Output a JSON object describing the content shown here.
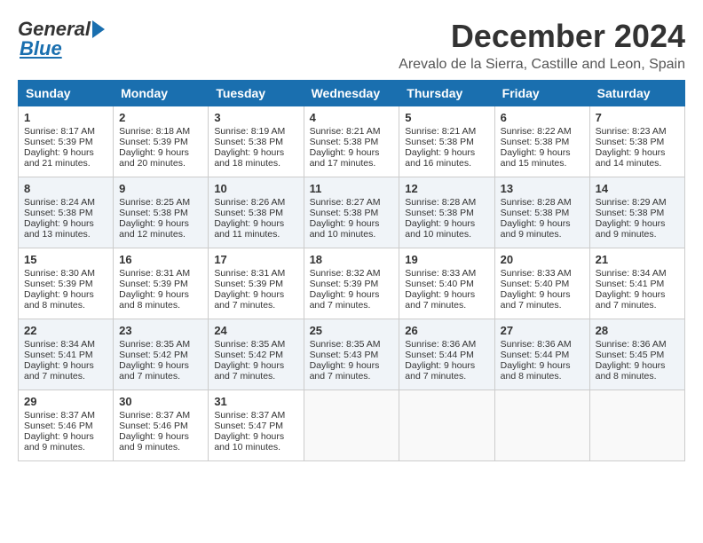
{
  "header": {
    "logo_general": "General",
    "logo_blue": "Blue",
    "month_title": "December 2024",
    "location": "Arevalo de la Sierra, Castille and Leon, Spain"
  },
  "weekdays": [
    "Sunday",
    "Monday",
    "Tuesday",
    "Wednesday",
    "Thursday",
    "Friday",
    "Saturday"
  ],
  "weeks": [
    [
      {
        "day": "1",
        "sunrise": "8:17 AM",
        "sunset": "5:39 PM",
        "daylight": "9 hours and 21 minutes."
      },
      {
        "day": "2",
        "sunrise": "8:18 AM",
        "sunset": "5:39 PM",
        "daylight": "9 hours and 20 minutes."
      },
      {
        "day": "3",
        "sunrise": "8:19 AM",
        "sunset": "5:38 PM",
        "daylight": "9 hours and 18 minutes."
      },
      {
        "day": "4",
        "sunrise": "8:21 AM",
        "sunset": "5:38 PM",
        "daylight": "9 hours and 17 minutes."
      },
      {
        "day": "5",
        "sunrise": "8:21 AM",
        "sunset": "5:38 PM",
        "daylight": "9 hours and 16 minutes."
      },
      {
        "day": "6",
        "sunrise": "8:22 AM",
        "sunset": "5:38 PM",
        "daylight": "9 hours and 15 minutes."
      },
      {
        "day": "7",
        "sunrise": "8:23 AM",
        "sunset": "5:38 PM",
        "daylight": "9 hours and 14 minutes."
      }
    ],
    [
      {
        "day": "8",
        "sunrise": "8:24 AM",
        "sunset": "5:38 PM",
        "daylight": "9 hours and 13 minutes."
      },
      {
        "day": "9",
        "sunrise": "8:25 AM",
        "sunset": "5:38 PM",
        "daylight": "9 hours and 12 minutes."
      },
      {
        "day": "10",
        "sunrise": "8:26 AM",
        "sunset": "5:38 PM",
        "daylight": "9 hours and 11 minutes."
      },
      {
        "day": "11",
        "sunrise": "8:27 AM",
        "sunset": "5:38 PM",
        "daylight": "9 hours and 10 minutes."
      },
      {
        "day": "12",
        "sunrise": "8:28 AM",
        "sunset": "5:38 PM",
        "daylight": "9 hours and 10 minutes."
      },
      {
        "day": "13",
        "sunrise": "8:28 AM",
        "sunset": "5:38 PM",
        "daylight": "9 hours and 9 minutes."
      },
      {
        "day": "14",
        "sunrise": "8:29 AM",
        "sunset": "5:38 PM",
        "daylight": "9 hours and 9 minutes."
      }
    ],
    [
      {
        "day": "15",
        "sunrise": "8:30 AM",
        "sunset": "5:39 PM",
        "daylight": "9 hours and 8 minutes."
      },
      {
        "day": "16",
        "sunrise": "8:31 AM",
        "sunset": "5:39 PM",
        "daylight": "9 hours and 8 minutes."
      },
      {
        "day": "17",
        "sunrise": "8:31 AM",
        "sunset": "5:39 PM",
        "daylight": "9 hours and 7 minutes."
      },
      {
        "day": "18",
        "sunrise": "8:32 AM",
        "sunset": "5:39 PM",
        "daylight": "9 hours and 7 minutes."
      },
      {
        "day": "19",
        "sunrise": "8:33 AM",
        "sunset": "5:40 PM",
        "daylight": "9 hours and 7 minutes."
      },
      {
        "day": "20",
        "sunrise": "8:33 AM",
        "sunset": "5:40 PM",
        "daylight": "9 hours and 7 minutes."
      },
      {
        "day": "21",
        "sunrise": "8:34 AM",
        "sunset": "5:41 PM",
        "daylight": "9 hours and 7 minutes."
      }
    ],
    [
      {
        "day": "22",
        "sunrise": "8:34 AM",
        "sunset": "5:41 PM",
        "daylight": "9 hours and 7 minutes."
      },
      {
        "day": "23",
        "sunrise": "8:35 AM",
        "sunset": "5:42 PM",
        "daylight": "9 hours and 7 minutes."
      },
      {
        "day": "24",
        "sunrise": "8:35 AM",
        "sunset": "5:42 PM",
        "daylight": "9 hours and 7 minutes."
      },
      {
        "day": "25",
        "sunrise": "8:35 AM",
        "sunset": "5:43 PM",
        "daylight": "9 hours and 7 minutes."
      },
      {
        "day": "26",
        "sunrise": "8:36 AM",
        "sunset": "5:44 PM",
        "daylight": "9 hours and 7 minutes."
      },
      {
        "day": "27",
        "sunrise": "8:36 AM",
        "sunset": "5:44 PM",
        "daylight": "9 hours and 8 minutes."
      },
      {
        "day": "28",
        "sunrise": "8:36 AM",
        "sunset": "5:45 PM",
        "daylight": "9 hours and 8 minutes."
      }
    ],
    [
      {
        "day": "29",
        "sunrise": "8:37 AM",
        "sunset": "5:46 PM",
        "daylight": "9 hours and 9 minutes."
      },
      {
        "day": "30",
        "sunrise": "8:37 AM",
        "sunset": "5:46 PM",
        "daylight": "9 hours and 9 minutes."
      },
      {
        "day": "31",
        "sunrise": "8:37 AM",
        "sunset": "5:47 PM",
        "daylight": "9 hours and 10 minutes."
      },
      null,
      null,
      null,
      null
    ]
  ],
  "labels": {
    "sunrise_prefix": "Sunrise: ",
    "sunset_prefix": "Sunset: ",
    "daylight_prefix": "Daylight: "
  }
}
